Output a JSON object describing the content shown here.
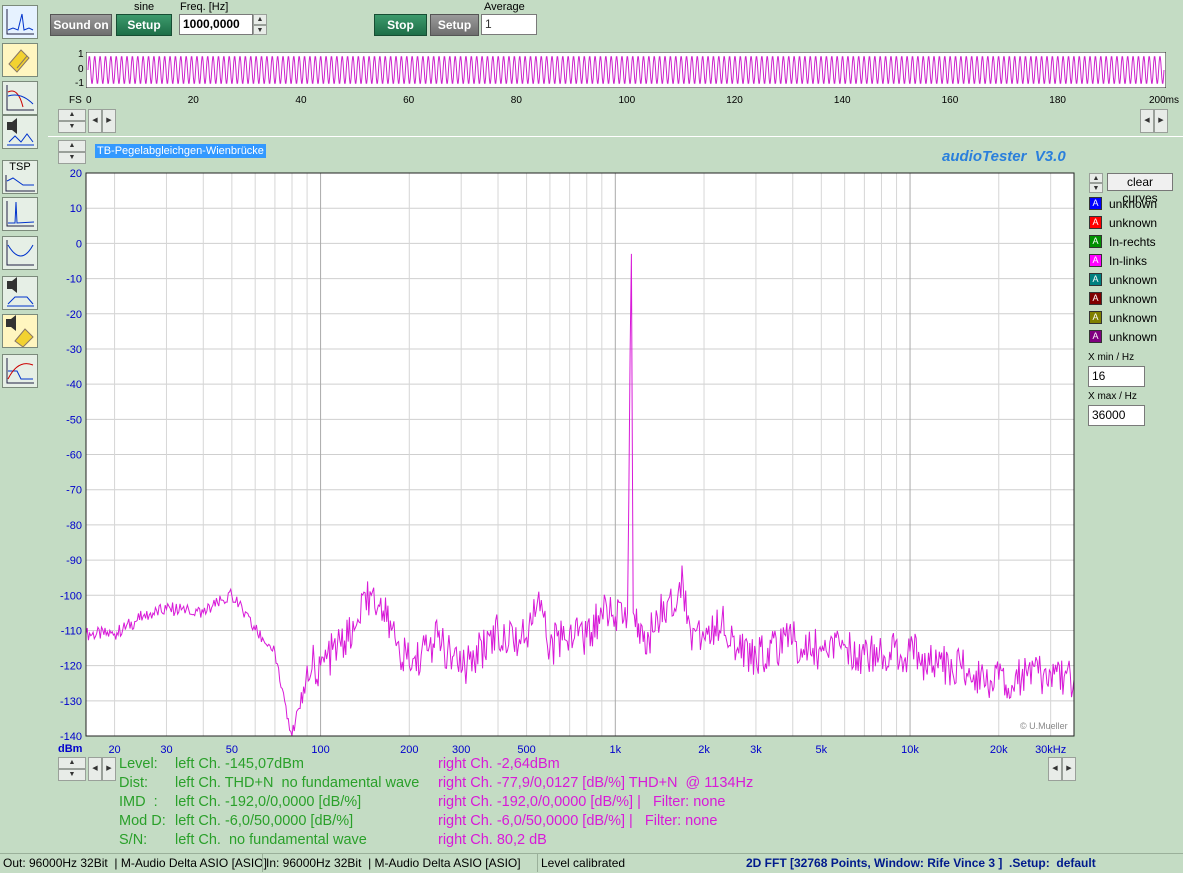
{
  "generator": {
    "waveform_label": "sine",
    "sound_button": "Sound on",
    "setup_button": "Setup",
    "freq_label": "Freq. [Hz]",
    "freq_value": "1000,0000"
  },
  "analyzer": {
    "stop_button": "Stop",
    "setup_button": "Setup",
    "average_label": "Average",
    "average_value": "1"
  },
  "scope": {
    "y_ticks": [
      "1",
      "0",
      "-1"
    ],
    "fs_label": "FS",
    "x_ticks": [
      "0",
      "20",
      "40",
      "60",
      "80",
      "100",
      "120",
      "140",
      "160",
      "180",
      "200ms"
    ],
    "x_values_ms": [
      0,
      20,
      40,
      60,
      80,
      100,
      120,
      140,
      160,
      180,
      200
    ],
    "signal_frequency_hz": 1000,
    "window_ms": 200
  },
  "curve_title": "TB-Pegelabgleichgen-Wienbrücke",
  "app_title": "audioTester  V3.0",
  "copyright": "© U.Mueller",
  "legend": {
    "clear_button": "clear curves",
    "items": [
      {
        "letter": "A",
        "label": "unknown",
        "color": "#0000ff"
      },
      {
        "letter": "A",
        "label": "unknown",
        "color": "#ff0000"
      },
      {
        "letter": "A",
        "label": "In-rechts",
        "color": "#009000"
      },
      {
        "letter": "A",
        "label": "In-links",
        "color": "#ff00ff"
      },
      {
        "letter": "A",
        "label": "unknown",
        "color": "#008080"
      },
      {
        "letter": "A",
        "label": "unknown",
        "color": "#800000"
      },
      {
        "letter": "A",
        "label": "unknown",
        "color": "#808000"
      },
      {
        "letter": "A",
        "label": "unknown",
        "color": "#800080"
      }
    ],
    "xmin_label": "X min / Hz",
    "xmin_value": "16",
    "xmax_label": "X max / Hz",
    "xmax_value": "36000"
  },
  "chart_data": {
    "type": "line",
    "y_unit_label": "dBm",
    "xlim": [
      16,
      36000
    ],
    "ylim": [
      -140,
      20
    ],
    "x_scale": "log",
    "grid": true,
    "y_ticks": [
      20,
      10,
      0,
      -10,
      -20,
      -30,
      -40,
      -50,
      -60,
      -70,
      -80,
      -90,
      -100,
      -110,
      -120,
      -130,
      -140
    ],
    "x_tick_labels": [
      "20",
      "30",
      "50",
      "100",
      "200",
      "300",
      "500",
      "1k",
      "2k",
      "3k",
      "5k",
      "10k",
      "20k",
      "30kHz"
    ],
    "x_tick_values": [
      20,
      30,
      50,
      100,
      200,
      300,
      500,
      1000,
      2000,
      3000,
      5000,
      10000,
      20000,
      30000
    ],
    "series": [
      {
        "name": "In-links",
        "color": "#d81ad8",
        "x": [
          16,
          20,
          25,
          30,
          35,
          40,
          50,
          60,
          70,
          80,
          90,
          100,
          130,
          150,
          200,
          250,
          300,
          400,
          500,
          550,
          600,
          700,
          800,
          900,
          1000,
          1100,
          1134,
          1150,
          1200,
          1300,
          1500,
          1700,
          1800,
          2000,
          2300,
          2600,
          3000,
          4000,
          5000,
          6000,
          7000,
          8000,
          10000,
          12000,
          15000,
          20000,
          25000,
          30000,
          36000
        ],
        "y": [
          -111,
          -111,
          -106,
          -104,
          -104,
          -105,
          -100,
          -110,
          -116,
          -140,
          -120,
          -120,
          -110,
          -99,
          -120,
          -112,
          -122,
          -110,
          -112,
          -99,
          -115,
          -110,
          -112,
          -105,
          -106,
          -105,
          -3,
          -105,
          -108,
          -112,
          -102,
          -97,
          -110,
          -112,
          -107,
          -115,
          -117,
          -113,
          -116,
          -114,
          -117,
          -116,
          -116,
          -120,
          -121,
          -124,
          -123,
          -122,
          -124
        ]
      }
    ]
  },
  "measurements": [
    {
      "name": "Level:",
      "left": "left Ch. -145,07dBm",
      "right": "right Ch. -2,64dBm"
    },
    {
      "name": "Dist:",
      "left": "left Ch. THD+N  no fundamental wave",
      "right": "right Ch. -77,9/0,0127 [dB/%] THD+N  @ 1134Hz"
    },
    {
      "name": "IMD  :",
      "left": "left Ch. -192,0/0,0000 [dB/%]",
      "right": "right Ch. -192,0/0,0000 [dB/%] |   Filter: none"
    },
    {
      "name": "Mod D:",
      "left": "left Ch. -6,0/50,0000 [dB/%]",
      "right": "right Ch. -6,0/50,0000 [dB/%] |   Filter: none"
    },
    {
      "name": "S/N:",
      "left": "left Ch.  no fundamental wave",
      "right": "right Ch. 80,2 dB"
    }
  ],
  "status": {
    "out": "Out: 96000Hz 32Bit  | M-Audio Delta ASIO [ASIO]",
    "in": "In: 96000Hz 32Bit  | M-Audio Delta ASIO [ASIO]",
    "calibration": "Level calibrated",
    "fft_info": "2D FFT [32768 Points, Window: Rife Vince 3 ]  .Setup:  default"
  },
  "tools": {
    "tsp_label": "TSP"
  }
}
